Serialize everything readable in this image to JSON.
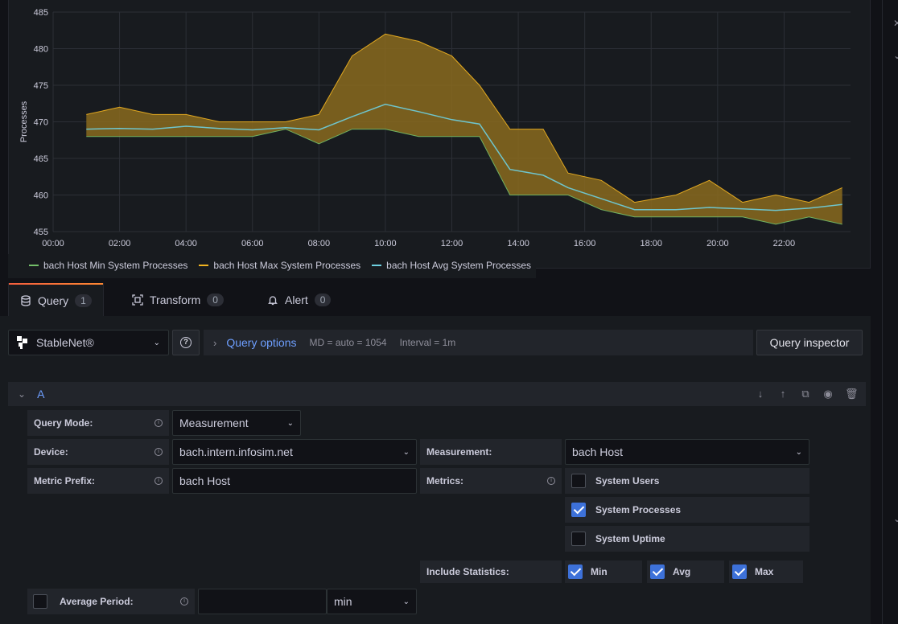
{
  "chart_data": {
    "type": "area",
    "ylabel": "Processes",
    "ylim": [
      455,
      485
    ],
    "yticks": [
      "455",
      "460",
      "465",
      "470",
      "475",
      "480",
      "485"
    ],
    "xticks": [
      "00:00",
      "02:00",
      "04:00",
      "06:00",
      "08:00",
      "10:00",
      "12:00",
      "14:00",
      "16:00",
      "18:00",
      "20:00",
      "22:00"
    ],
    "x": [
      "01:00",
      "02:00",
      "03:00",
      "04:00",
      "05:00",
      "06:00",
      "07:00",
      "08:00",
      "09:00",
      "10:00",
      "11:00",
      "12:00",
      "12:50",
      "13:45",
      "14:45",
      "15:30",
      "16:30",
      "17:30",
      "18:45",
      "19:45",
      "20:45",
      "21:45",
      "22:45",
      "23:45"
    ],
    "series": [
      {
        "name": "bach Host Min System Processes",
        "color": "#73bf69",
        "values": [
          468,
          468,
          468,
          468,
          468,
          468,
          469,
          467,
          469,
          469,
          468,
          468,
          468,
          460,
          460,
          460,
          458,
          457,
          457,
          457,
          457,
          456,
          457,
          456
        ]
      },
      {
        "name": "bach Host Max System Processes",
        "color": "#f2b420",
        "values": [
          471,
          472,
          471,
          471,
          470,
          470,
          470,
          471,
          479,
          482,
          481,
          479,
          475,
          469,
          469,
          463,
          462,
          459,
          460,
          462,
          459,
          460,
          459,
          461
        ]
      },
      {
        "name": "bach Host Avg System Processes",
        "color": "#6ed0e0",
        "values": [
          469,
          469.1,
          469,
          469.4,
          469.1,
          468.9,
          469.2,
          468.9,
          470.7,
          472.4,
          471.4,
          470.3,
          469.7,
          463.5,
          462.7,
          461,
          459.5,
          458,
          458,
          458.3,
          458.1,
          457.9,
          458.2,
          458.7
        ]
      }
    ],
    "grid": true,
    "legend": "bottom-left"
  },
  "tabs": [
    {
      "label": "Query",
      "count": "1",
      "icon": "database-icon"
    },
    {
      "label": "Transform",
      "count": "0",
      "icon": "transform-icon"
    },
    {
      "label": "Alert",
      "count": "0",
      "icon": "bell-icon"
    }
  ],
  "toolbar": {
    "datasource": "StableNet®",
    "query_options_label": "Query options",
    "md": "MD = auto = 1054",
    "interval": "Interval = 1m",
    "inspector_label": "Query inspector"
  },
  "query": {
    "ref": "A",
    "query_mode_label": "Query Mode:",
    "query_mode_value": "Measurement",
    "device_label": "Device:",
    "device_value": "bach.intern.infosim.net",
    "measurement_label": "Measurement:",
    "measurement_value": "bach Host",
    "metric_prefix_label": "Metric Prefix:",
    "metric_prefix_value": "bach Host",
    "metrics_label": "Metrics:",
    "metrics": [
      {
        "label": "System Users",
        "checked": false
      },
      {
        "label": "System Processes",
        "checked": true
      },
      {
        "label": "System Uptime",
        "checked": false
      }
    ],
    "include_stats_label": "Include Statistics:",
    "stats": [
      {
        "label": "Min",
        "checked": true
      },
      {
        "label": "Avg",
        "checked": true
      },
      {
        "label": "Max",
        "checked": true
      }
    ],
    "average_period_label": "Average Period:",
    "average_period_value": "",
    "average_unit": "min"
  }
}
